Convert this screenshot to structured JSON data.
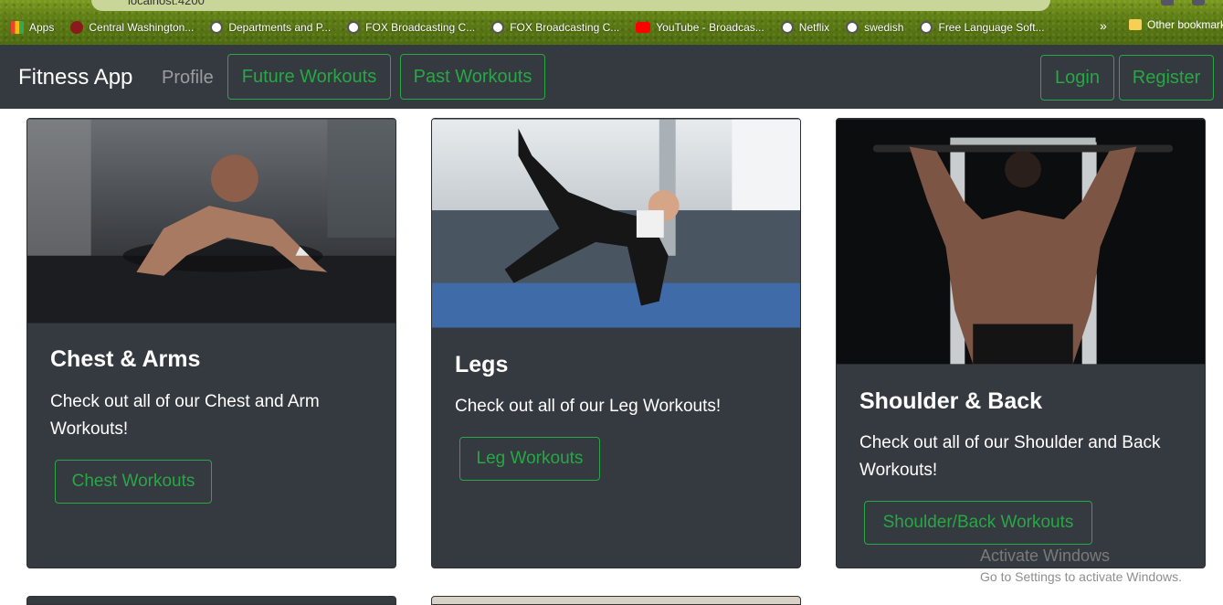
{
  "browser": {
    "url": "localhost:4200",
    "bookmarks": [
      {
        "label": "Apps",
        "icon": "apps-grid-icon"
      },
      {
        "label": "Central Washington...",
        "icon": "cwu-icon"
      },
      {
        "label": "Departments and P...",
        "icon": "globe-icon"
      },
      {
        "label": "FOX Broadcasting C...",
        "icon": "globe-icon"
      },
      {
        "label": "FOX Broadcasting C...",
        "icon": "globe-icon"
      },
      {
        "label": "YouTube - Broadcas...",
        "icon": "youtube-icon"
      },
      {
        "label": "Netflix",
        "icon": "globe-icon"
      },
      {
        "label": "swedish",
        "icon": "globe-icon"
      },
      {
        "label": "Free Language Soft...",
        "icon": "globe-icon"
      }
    ],
    "more_label": "»",
    "other_bookmarks": "Other bookmarks"
  },
  "navbar": {
    "brand": "Fitness App",
    "profile": "Profile",
    "future_workouts": "Future Workouts",
    "past_workouts": "Past Workouts",
    "login": "Login",
    "register": "Register",
    "accent_color": "#28a745"
  },
  "cards": [
    {
      "title": "Chest & Arms",
      "text": "Check out all of our Chest and Arm Workouts!",
      "button": "Chest Workouts"
    },
    {
      "title": "Legs",
      "text": "Check out all of our Leg Workouts!",
      "button": "Leg Workouts"
    },
    {
      "title": "Shoulder & Back",
      "text": "Check out all of our Shoulder and Back Workouts!",
      "button": "Shoulder/Back Workouts"
    }
  ],
  "watermark": {
    "title": "Activate Windows",
    "subtitle": "Go to Settings to activate Windows."
  }
}
